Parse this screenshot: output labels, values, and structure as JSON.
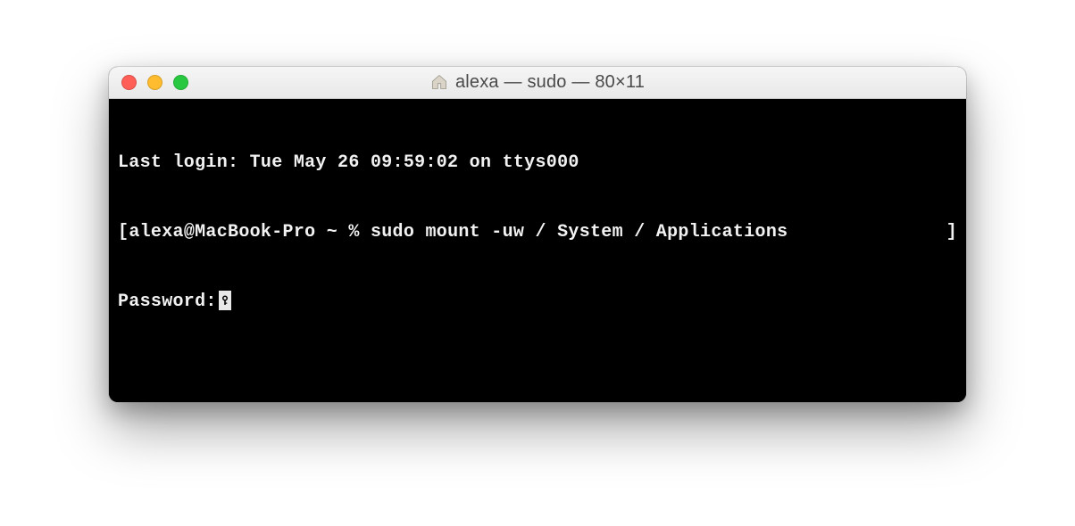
{
  "titlebar": {
    "title": "alexa — sudo — 80×11"
  },
  "terminal": {
    "last_login_line": "Last login: Tue May 26 09:59:02 on ttys000",
    "prompt_open_bracket": "[",
    "prompt_text": "alexa@MacBook-Pro ~ % sudo mount -uw / System / Applications",
    "prompt_close_bracket": "]",
    "password_label": "Password:"
  }
}
